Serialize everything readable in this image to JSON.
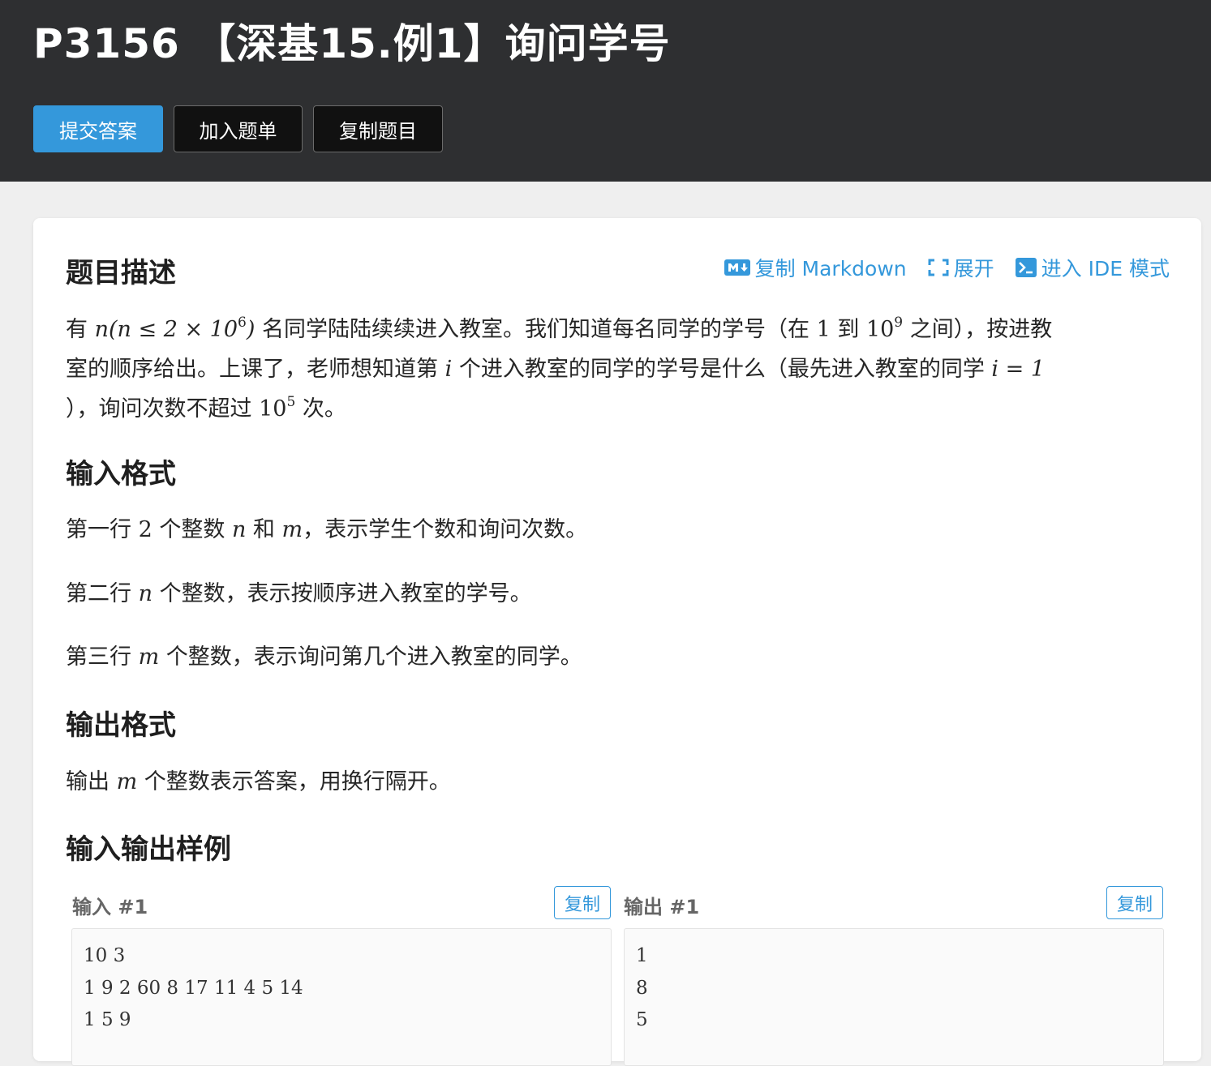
{
  "header": {
    "title": "P3156 【深基15.例1】询问学号",
    "buttons": {
      "submit": "提交答案",
      "add_to_list": "加入题单",
      "copy_problem": "复制题目"
    }
  },
  "toolbar": {
    "copy_markdown": "复制 Markdown",
    "expand": "展开",
    "enter_ide": "进入 IDE 模式"
  },
  "sections": {
    "description": {
      "heading": "题目描述",
      "line1": {
        "t1": "有 ",
        "m1": "n(n ≤ 2 × 10",
        "m1_sup": "6",
        "m1_end": ")",
        "t2": " 名同学陆陆续续进入教室。我们知道每名同学的学号（在 ",
        "m2": "1",
        "t3": " 到 ",
        "m3": "10",
        "m3_sup": "9",
        "t4": " 之间），按进教"
      },
      "line2": {
        "t1": "室的顺序给出。上课了，老师想知道第 ",
        "m1": "i",
        "t2": " 个进入教室的同学的学号是什么（最先进入教室的同学 ",
        "m2": "i = 1"
      },
      "line3": {
        "t1": "），询问次数不超过 ",
        "m1": "10",
        "m1_sup": "5",
        "t2": " 次。"
      }
    },
    "input_format": {
      "heading": "输入格式",
      "p1": {
        "t1": "第一行 ",
        "m1": "2",
        "t2": " 个整数 ",
        "m2": "n",
        "t3": " 和 ",
        "m3": "m",
        "t4": "，表示学生个数和询问次数。"
      },
      "p2": {
        "t1": "第二行 ",
        "m1": "n",
        "t2": " 个整数，表示按顺序进入教室的学号。"
      },
      "p3": {
        "t1": "第三行 ",
        "m1": "m",
        "t2": " 个整数，表示询问第几个进入教室的同学。"
      }
    },
    "output_format": {
      "heading": "输出格式",
      "p1": {
        "t1": "输出 ",
        "m1": "m",
        "t2": " 个整数表示答案，用换行隔开。"
      }
    },
    "samples": {
      "heading": "输入输出样例",
      "input_label": "输入 #1",
      "output_label": "输出 #1",
      "copy_label": "复制",
      "input_lines": [
        "10 3",
        "1 9 2 60 8 17 11 4 5 14",
        "1 5 9"
      ],
      "output_lines": [
        "1",
        "8",
        "5"
      ]
    }
  },
  "colors": {
    "accent": "#3498db",
    "header_bg": "#2e2f31",
    "page_bg": "#efefef"
  }
}
